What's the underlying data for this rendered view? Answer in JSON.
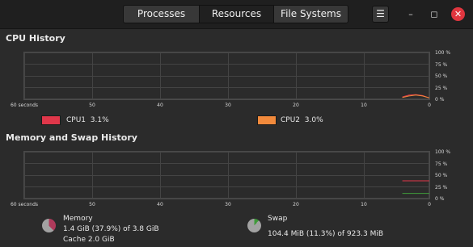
{
  "tabs": [
    {
      "label": "Processes",
      "active": false
    },
    {
      "label": "Resources",
      "active": true
    },
    {
      "label": "File Systems",
      "active": false
    }
  ],
  "window": {
    "menu_icon": "hamburger-menu-icon",
    "minimize_icon": "minimize-icon",
    "maximize_icon": "maximize-icon",
    "close_icon": "close-icon",
    "menu_glyph": "☰",
    "minimize_glyph": "–",
    "maximize_glyph": "◻",
    "close_glyph": "✕",
    "close_color": "#e0363f"
  },
  "cpu": {
    "title": "CPU History",
    "cpu1_label": "CPU1",
    "cpu1_value": "3.1%",
    "cpu1_color": "#e0374a",
    "cpu2_label": "CPU2",
    "cpu2_value": "3.0%",
    "cpu2_color": "#f28a3c"
  },
  "memory": {
    "title": "Memory and Swap History",
    "memory_label": "Memory",
    "memory_value": "1.4 GiB (37.9%) of 3.8 GiB",
    "cache_value": "Cache 2.0 GiB",
    "memory_color": "#b03a5b",
    "swap_label": "Swap",
    "swap_value": "104.4 MiB (11.3%) of 923.3 MiB",
    "swap_color": "#3f9a3a"
  },
  "axis": {
    "y_ticks": [
      "100 %",
      "75 %",
      "50 %",
      "25 %",
      "0 %"
    ],
    "x_ticks": [
      "60 seconds",
      "50",
      "40",
      "30",
      "20",
      "10",
      "0"
    ]
  },
  "chart_data": [
    {
      "type": "line",
      "title": "CPU History",
      "xlim": [
        60,
        0
      ],
      "ylim": [
        0,
        100
      ],
      "series": [
        {
          "name": "CPU1",
          "color": "#e0374a",
          "x": [
            4,
            3,
            2,
            1,
            0
          ],
          "values": [
            5,
            9,
            10,
            8,
            3
          ]
        },
        {
          "name": "CPU2",
          "color": "#f28a3c",
          "x": [
            4,
            3,
            2,
            1,
            0
          ],
          "values": [
            4,
            7,
            9,
            7,
            3
          ]
        }
      ]
    },
    {
      "type": "line",
      "title": "Memory and Swap History",
      "xlim": [
        60,
        0
      ],
      "ylim": [
        0,
        100
      ],
      "series": [
        {
          "name": "Memory",
          "color": "#e0374a",
          "x": [
            4,
            0
          ],
          "values": [
            38,
            38
          ]
        },
        {
          "name": "Swap",
          "color": "#3f9a3a",
          "x": [
            4,
            0
          ],
          "values": [
            11,
            11
          ]
        }
      ]
    }
  ]
}
